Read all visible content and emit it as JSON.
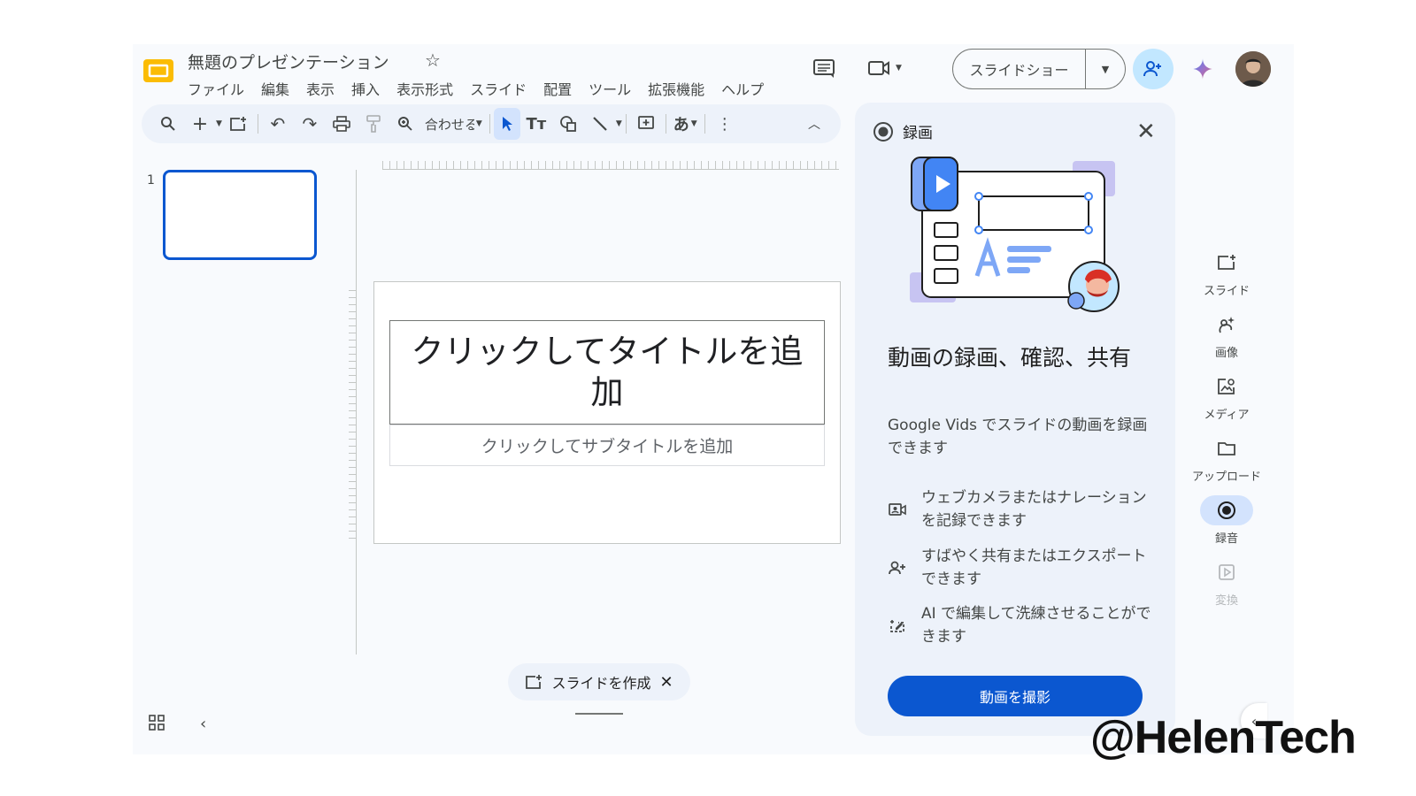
{
  "header": {
    "doc_title": "無題のプレゼンテーション",
    "menu": [
      "ファイル",
      "編集",
      "表示",
      "挿入",
      "表示形式",
      "スライド",
      "配置",
      "ツール",
      "拡張機能",
      "ヘルプ"
    ],
    "slideshow_label": "スライドショー"
  },
  "toolbar": {
    "zoom_label": "合わせる",
    "input_tool_label": "あ"
  },
  "filmstrip": {
    "slide_number": "1"
  },
  "slide": {
    "title_placeholder": "クリックしてタイトルを追加",
    "subtitle_placeholder": "クリックしてサブタイトルを追加"
  },
  "create_chip": {
    "label": "スライドを作成"
  },
  "panel": {
    "title": "録画",
    "heading": "動画の録画、確認、共有",
    "description": "Google Vids でスライドの動画を録画できます",
    "features": [
      {
        "icon": "webcam-icon",
        "text": "ウェブカメラまたはナレーションを記録できます"
      },
      {
        "icon": "share-person-icon",
        "text": "すばやく共有またはエクスポートできます"
      },
      {
        "icon": "ai-edit-icon",
        "text": "AI で編集して洗練させることができます"
      }
    ],
    "record_button": "動画を撮影"
  },
  "side_panel": {
    "items": [
      {
        "label": "スライド",
        "icon": "add-slide-icon",
        "state": "normal"
      },
      {
        "label": "画像",
        "icon": "image-spark-icon",
        "state": "normal"
      },
      {
        "label": "メディア",
        "icon": "media-icon",
        "state": "normal"
      },
      {
        "label": "アップロード",
        "icon": "folder-icon",
        "state": "normal"
      },
      {
        "label": "録音",
        "icon": "record-icon",
        "state": "active"
      },
      {
        "label": "変換",
        "icon": "convert-icon",
        "state": "disabled"
      }
    ]
  },
  "watermark": "@HelenTech",
  "colors": {
    "accent": "#0b57d0",
    "panel_bg": "#edf2fa",
    "share_bg": "#c2e7ff",
    "logo": "#fbbc04"
  }
}
